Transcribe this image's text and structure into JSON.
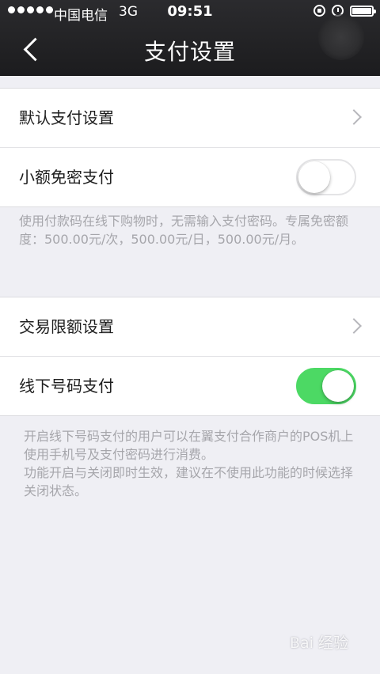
{
  "status_bar": {
    "carrier": "中国电信",
    "network": "3G",
    "time": "09:51",
    "icons": [
      "signal-dots-icon",
      "rotation-lock-icon",
      "alarm-icon",
      "battery-icon"
    ]
  },
  "nav": {
    "back_icon": "chevron-left-icon",
    "title": "支付设置"
  },
  "group1": {
    "default_payment": "默认支付设置",
    "small_amount": "小额免密支付",
    "small_amount_enabled": false
  },
  "note1": "使用付款码在线下购物时，无需输入支付密码。专属免密额度：500.00元/次，500.00元/日，500.00元/月。",
  "group2": {
    "limit_settings": "交易限额设置",
    "offline_number_pay": "线下号码支付",
    "offline_number_pay_enabled": true
  },
  "note2": {
    "line1": "开启线下号码支付的用户可以在翼支付合作商户的POS机上使用手机号及支付密码进行消费。",
    "line2": "功能开启与关闭即时生效，建议在不使用此功能的时候选择关闭状态。"
  },
  "colors": {
    "toggle_on": "#4cd964",
    "background": "#efeff4",
    "topbar": "#1c1c1e"
  },
  "watermark": "Bai 经验"
}
